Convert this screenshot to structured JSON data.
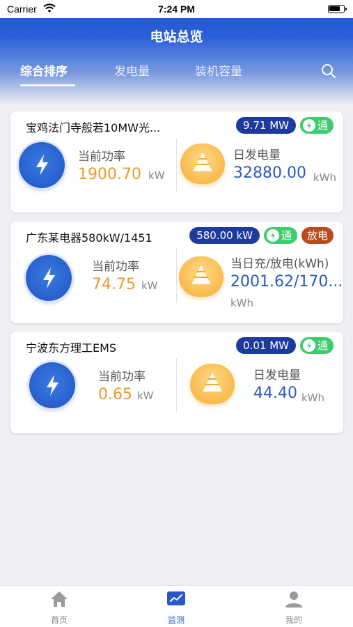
{
  "status": {
    "carrier": "Carrier",
    "time": "7:24 PM"
  },
  "nav": {
    "title": "电站总览"
  },
  "tabs": [
    {
      "label": "综合排序",
      "active": true
    },
    {
      "label": "发电量",
      "active": false
    },
    {
      "label": "装机容量",
      "active": false
    }
  ],
  "stations": [
    {
      "name": "宝鸡法门寺般若10MW光...",
      "capacity": "9.71 MW",
      "status": "通",
      "power_label": "当前功率",
      "power_value": "1900.70",
      "power_unit": "kW",
      "energy_label": "日发电量",
      "energy_value": "32880.00",
      "energy_unit": "kWh"
    },
    {
      "name": "广东某电器580kW/1451",
      "capacity": "580.00 kW",
      "status": "通",
      "mode": "放电",
      "power_label": "当前功率",
      "power_value": "74.75",
      "power_unit": "kW",
      "energy_label": "当日充/放电(kWh)",
      "energy_value": "2001.62/170...",
      "energy_unit": "kWh"
    },
    {
      "name": "宁波东方理工EMS",
      "capacity": "0.01 MW",
      "status": "通",
      "power_label": "当前功率",
      "power_value": "0.65",
      "power_unit": "kW",
      "energy_label": "日发电量",
      "energy_value": "44.40",
      "energy_unit": "kWh"
    }
  ],
  "tabbar": [
    {
      "label": "首页",
      "icon": "home-icon",
      "active": false
    },
    {
      "label": "监测",
      "icon": "monitor-icon",
      "active": true
    },
    {
      "label": "我的",
      "icon": "user-icon",
      "active": false
    }
  ],
  "colors": {
    "primary": "#1f4fd6",
    "power_value": "#ef9a2b",
    "energy_value": "#2a58c8",
    "ok_badge": "#3ecb6e",
    "capacity_badge": "#1d3a9e",
    "discharge_badge": "#b84a1c"
  }
}
